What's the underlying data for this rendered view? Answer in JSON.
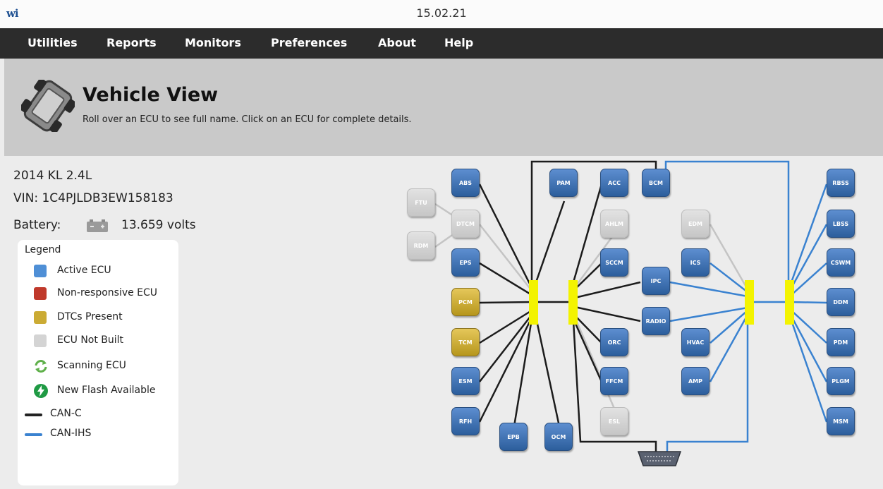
{
  "window": {
    "logo": "wi",
    "title": "15.02.21"
  },
  "menu": [
    "Utilities",
    "Reports",
    "Monitors",
    "Preferences",
    "About",
    "Help"
  ],
  "header": {
    "title": "Vehicle View",
    "subtitle": "Roll over an ECU to see full name. Click on an ECU for complete details.",
    "icon": "vehicle-chassis-icon"
  },
  "vehicle": {
    "model": "2014 KL 2.4L",
    "vin": "VIN: 1C4PJLDB3EW158183",
    "battery_label": "Battery:",
    "battery_icon": "battery-icon",
    "battery_value": "13.659 volts"
  },
  "legend": {
    "title": "Legend",
    "items": [
      {
        "label": "Active ECU",
        "color": "#4f8fd6"
      },
      {
        "label": "Non-responsive ECU",
        "color": "#c0392b"
      },
      {
        "label": "DTCs Present",
        "color": "#cbab34"
      },
      {
        "label": "ECU Not Built",
        "color": "#d4d4d4"
      },
      {
        "label": "Scanning ECU",
        "icon": "refresh-icon",
        "color": "#5fb04a"
      },
      {
        "label": "New Flash Available",
        "icon": "lightning-icon",
        "color": "#1f9a44"
      },
      {
        "label": "CAN-C",
        "color": "#222222"
      },
      {
        "label": "CAN-IHS",
        "color": "#3a82d0"
      }
    ]
  },
  "ecus": {
    "abs": "ABS",
    "ftu": "FTU",
    "dtcm": "DTCM",
    "rdm": "RDM",
    "eps": "EPS",
    "pcm": "PCM",
    "tcm": "TCM",
    "esm": "ESM",
    "rfh": "RFH",
    "epb": "EPB",
    "ocm": "OCM",
    "pam": "PAM",
    "acc": "ACC",
    "ahlm": "AHLM",
    "sccm": "SCCM",
    "orc": "ORC",
    "ffcm": "FFCM",
    "esl": "ESL",
    "bcm": "BCM",
    "ipc": "IPC",
    "radio": "RADIO",
    "edm": "EDM",
    "ics": "ICS",
    "hvac": "HVAC",
    "amp": "AMP",
    "rbss": "RBSS",
    "lbss": "LBSS",
    "cswm": "CSWM",
    "ddm": "DDM",
    "pdm": "PDM",
    "plgm": "PLGM",
    "msm": "MSM"
  },
  "ecu_status": {
    "active": "#4f8fd6",
    "dtc": "#cbab34",
    "not_built": "#d4d4d4"
  },
  "connector_icon": "dlc-connector-icon"
}
